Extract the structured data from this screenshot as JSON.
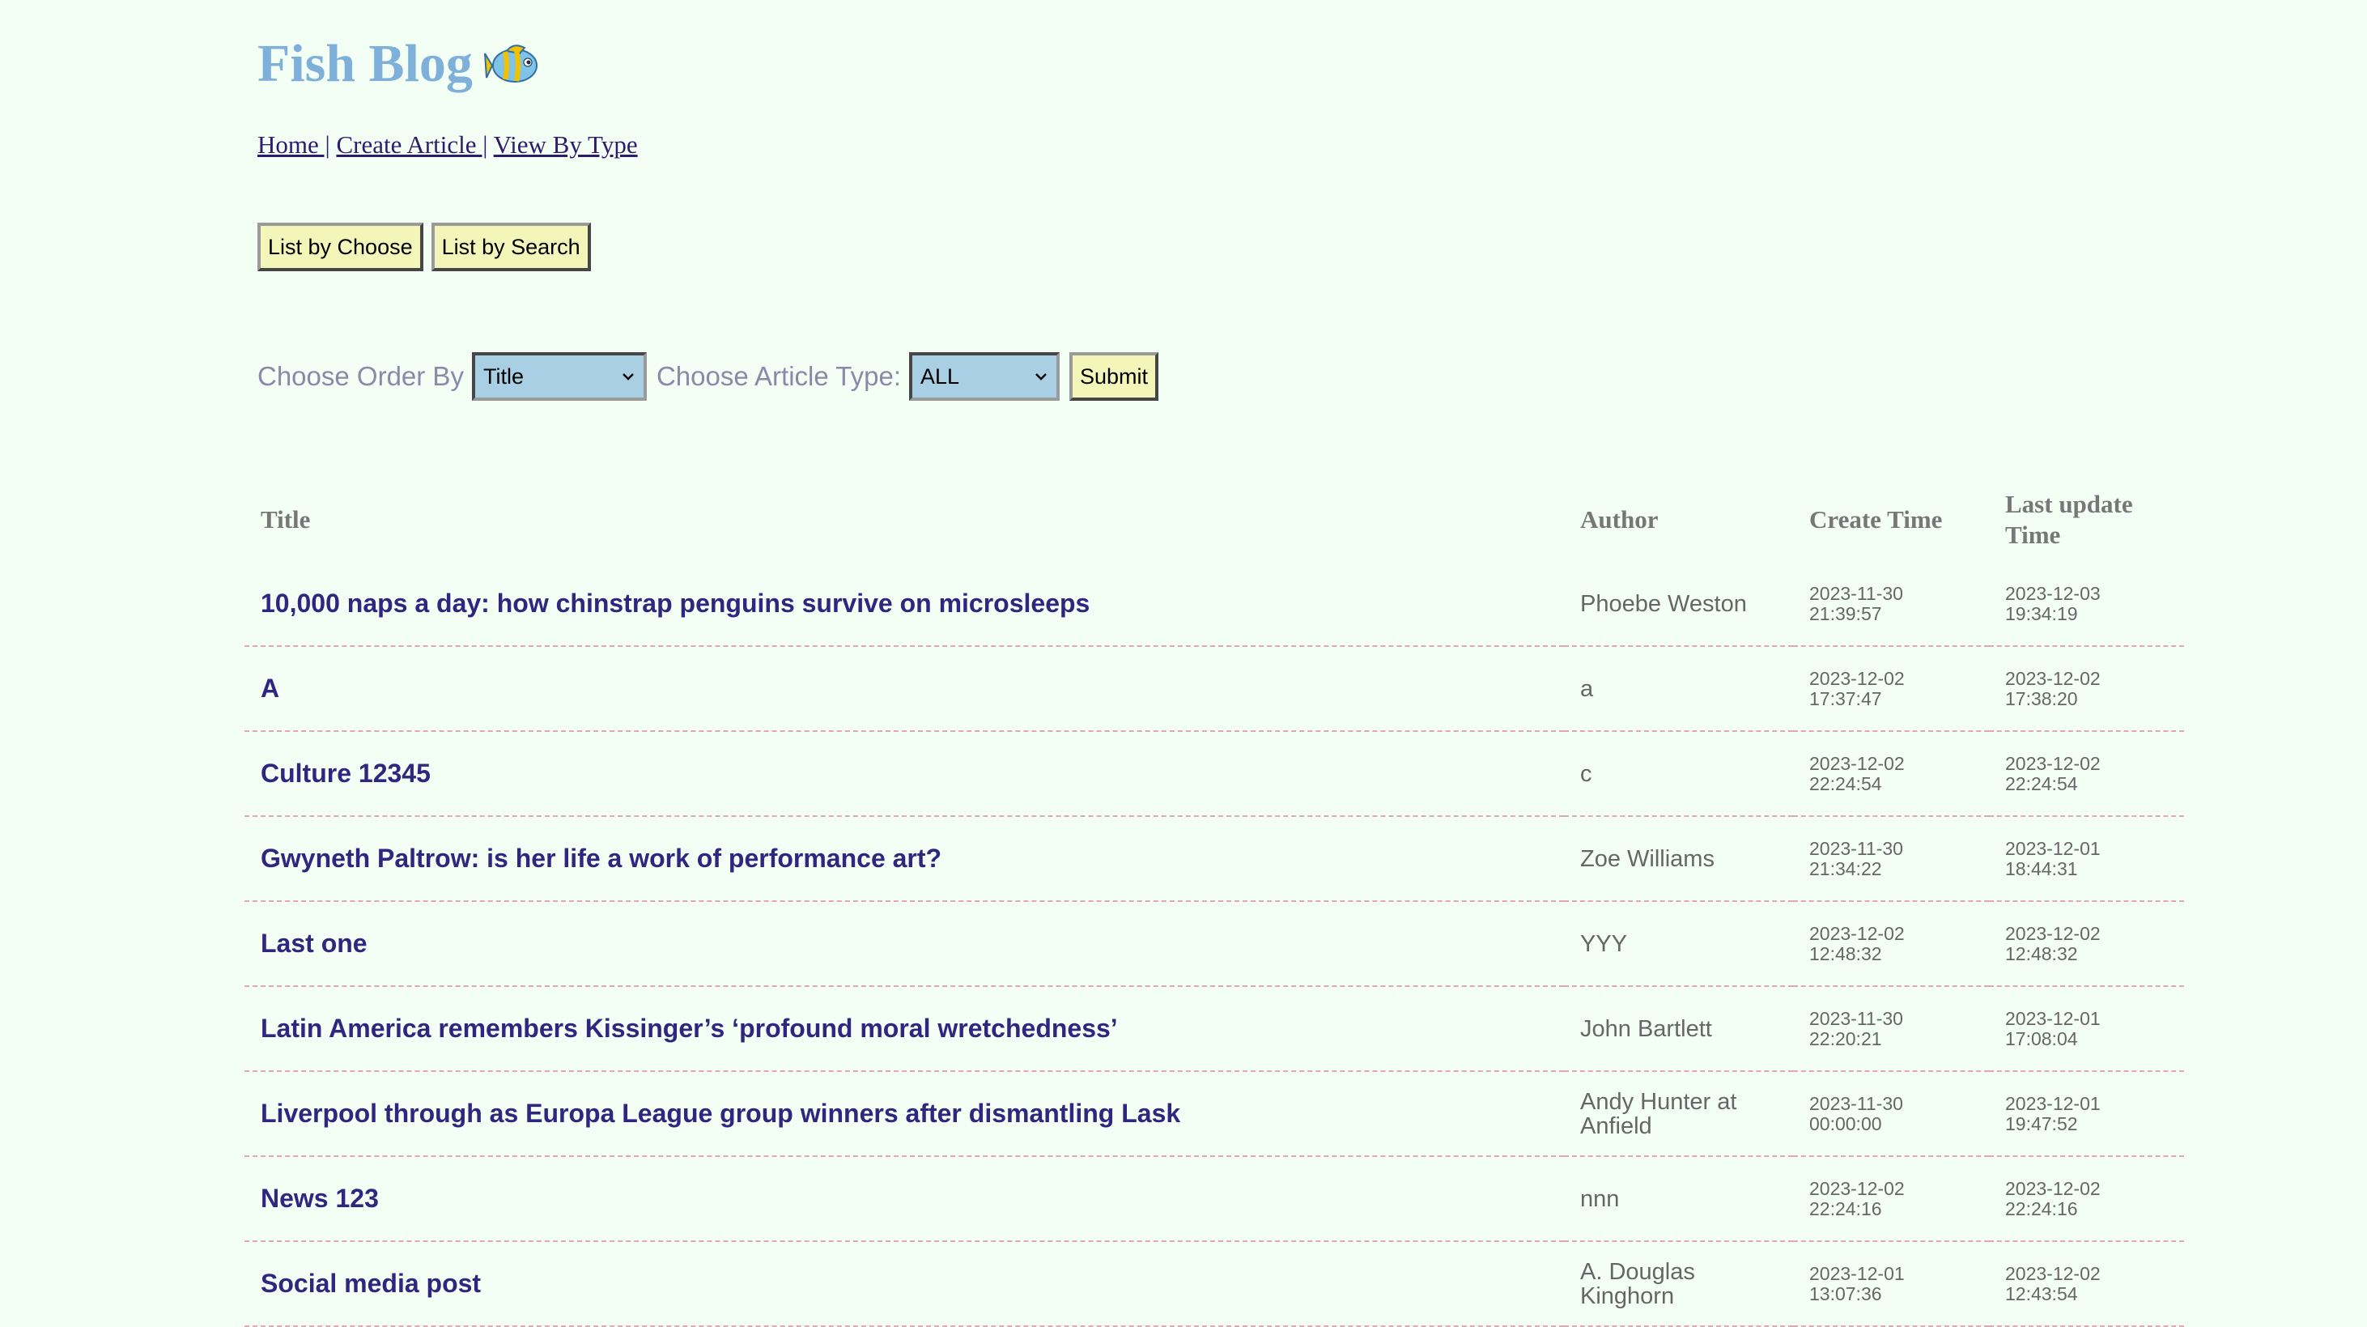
{
  "site": {
    "title": "Fish Blog",
    "logo_icon": "fish-icon"
  },
  "nav": {
    "items": [
      {
        "label": "Home |"
      },
      {
        "label": "Create Article |"
      },
      {
        "label": "View By Type"
      }
    ]
  },
  "tabs": {
    "list_by_choose": "List by Choose",
    "list_by_search": "List by Search"
  },
  "filters": {
    "order_label": "Choose Order By",
    "order_value": "Title",
    "type_label": "Choose Article Type:",
    "type_value": "ALL",
    "submit_label": "Submit"
  },
  "table": {
    "headers": {
      "title": "Title",
      "author": "Author",
      "create_time": "Create Time",
      "last_update_line1": "Last update",
      "last_update_line2": "Time"
    },
    "rows": [
      {
        "title": "10,000 naps a day: how chinstrap penguins survive on microsleeps",
        "author_line1": "Phoebe Weston",
        "author_line2": "",
        "create_date": "2023-11-30",
        "create_clock": "21:39:57",
        "update_date": "2023-12-03",
        "update_clock": "19:34:19"
      },
      {
        "title": "A",
        "author_line1": "a",
        "author_line2": "",
        "create_date": "2023-12-02",
        "create_clock": "17:37:47",
        "update_date": "2023-12-02",
        "update_clock": "17:38:20"
      },
      {
        "title": "Culture 12345",
        "author_line1": "c",
        "author_line2": "",
        "create_date": "2023-12-02",
        "create_clock": "22:24:54",
        "update_date": "2023-12-02",
        "update_clock": "22:24:54"
      },
      {
        "title": "Gwyneth Paltrow: is her life a work of performance art?",
        "author_line1": "Zoe Williams",
        "author_line2": "",
        "create_date": "2023-11-30",
        "create_clock": "21:34:22",
        "update_date": "2023-12-01",
        "update_clock": "18:44:31"
      },
      {
        "title": "Last one",
        "author_line1": "YYY",
        "author_line2": "",
        "create_date": "2023-12-02",
        "create_clock": "12:48:32",
        "update_date": "2023-12-02",
        "update_clock": "12:48:32"
      },
      {
        "title": "Latin America remembers Kissinger’s ‘profound moral wretchedness’",
        "author_line1": "John Bartlett",
        "author_line2": "",
        "create_date": "2023-11-30",
        "create_clock": "22:20:21",
        "update_date": "2023-12-01",
        "update_clock": "17:08:04"
      },
      {
        "title": "Liverpool through as Europa League group winners after dismantling Lask",
        "author_line1": "Andy Hunter at",
        "author_line2": "Anfield",
        "create_date": "2023-11-30",
        "create_clock": "00:00:00",
        "update_date": "2023-12-01",
        "update_clock": "19:47:52"
      },
      {
        "title": "News 123",
        "author_line1": "nnn",
        "author_line2": "",
        "create_date": "2023-12-02",
        "create_clock": "22:24:16",
        "update_date": "2023-12-02",
        "update_clock": "22:24:16"
      },
      {
        "title": "Social media post",
        "author_line1": "A. Douglas",
        "author_line2": "Kinghorn",
        "create_date": "2023-12-01",
        "create_clock": "13:07:36",
        "update_date": "2023-12-02",
        "update_clock": "12:43:54"
      }
    ]
  }
}
